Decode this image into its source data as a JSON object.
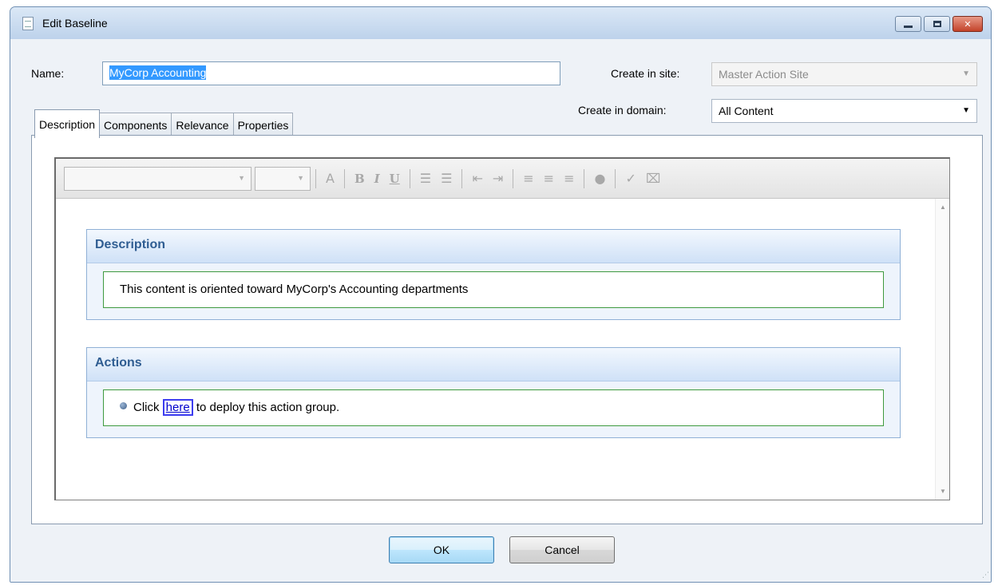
{
  "window": {
    "title": "Edit Baseline",
    "controls": [
      "minimize",
      "maximize",
      "close"
    ]
  },
  "form": {
    "name_label": "Name:",
    "name_value": "MyCorp Accounting",
    "site_label": "Create in site:",
    "site_value": "Master Action Site",
    "domain_label": "Create in domain:",
    "domain_value": "All Content"
  },
  "tabs": [
    {
      "label": "Description",
      "active": true
    },
    {
      "label": "Components",
      "active": false
    },
    {
      "label": "Relevance",
      "active": false
    },
    {
      "label": "Properties",
      "active": false
    }
  ],
  "editor": {
    "toolbar_icons": [
      "font-family-select",
      "font-size-select",
      "font-color-icon",
      "bold-icon",
      "italic-icon",
      "underline-icon",
      "numbered-list-icon",
      "bullet-list-icon",
      "outdent-icon",
      "indent-icon",
      "align-left-icon",
      "align-center-icon",
      "align-right-icon",
      "insert-link-icon",
      "spellcheck-icon",
      "clear-format-icon"
    ],
    "toolbar_glyphs": {
      "font_color": "A",
      "bold": "B",
      "italic": "I",
      "underline": "U",
      "numbered_list": "☰",
      "bullet_list": "☰",
      "outdent": "⇤",
      "indent": "⇥",
      "align_left": "≡",
      "align_center": "≡",
      "align_right": "≡",
      "link": "●",
      "spellcheck": "✓",
      "clear_format": "⌧"
    },
    "sections": [
      {
        "heading": "Description",
        "text": "This content is oriented toward MyCorp's Accounting departments"
      },
      {
        "heading": "Actions",
        "prefix": "Click",
        "link": "here",
        "suffix": "to deploy this action group."
      }
    ]
  },
  "buttons": {
    "ok": "OK",
    "cancel": "Cancel"
  },
  "colors": {
    "section_heading": "#2f5d92",
    "section_border": "#8fb0d6",
    "body_box_border": "#3f9a3f",
    "link": "#0000cc",
    "selection": "#3399ff"
  }
}
